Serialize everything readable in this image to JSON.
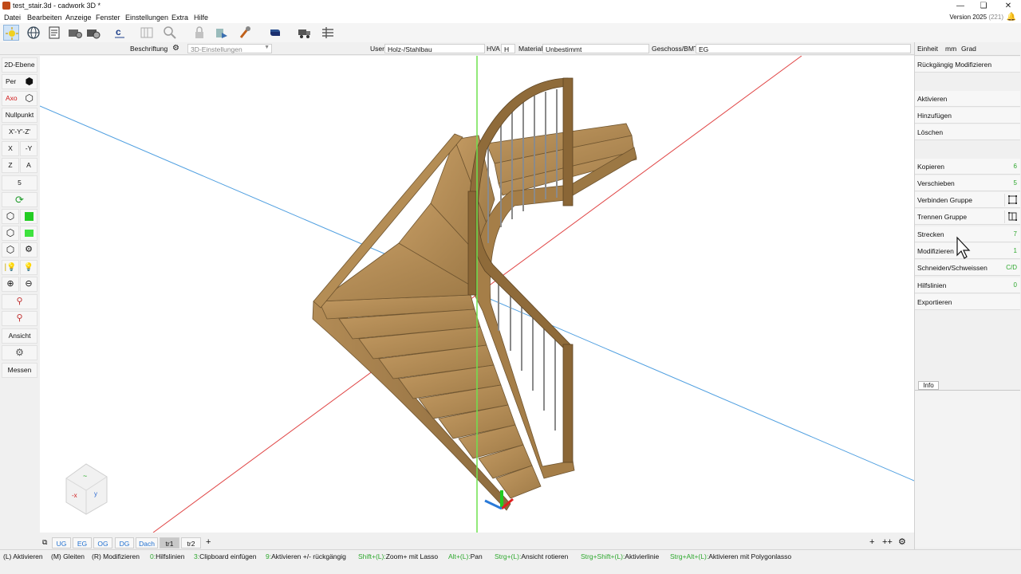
{
  "window": {
    "title": "test_stair.3d - cadwork 3D *",
    "version_label": "Version 2025",
    "version_build": "(221)"
  },
  "menu": [
    "Datei",
    "Bearbeiten",
    "Anzeige",
    "Fenster",
    "Einstellungen",
    "Extra",
    "Hilfe"
  ],
  "propbar": {
    "beschriftung": "Beschriftung",
    "einstellungen_3d": "3D-Einstellungen",
    "user_label": "User",
    "user_value": "Holz-/Stahlbau",
    "hva_label": "HVA",
    "hva_value": "H",
    "material_label": "Material",
    "material_value": "Unbestimmt",
    "geschoss_label": "Geschoss/BMT",
    "geschoss_value": "EG"
  },
  "right_header": {
    "einheit": "Einheit",
    "unit": "mm",
    "angle": "Grad"
  },
  "left_toolbar": {
    "ebene_2d": "2D-Ebene",
    "per": "Per",
    "axo": "Axo",
    "nullpunkt": "Nullpunkt",
    "axes": "X'-Y'-Z'",
    "x": "X",
    "neg_y": "-Y",
    "z": "Z",
    "a": "A",
    "five": "5",
    "ansicht": "Ansicht",
    "messen": "Messen"
  },
  "right_panel": {
    "undo": "Rückgängig Modifizieren",
    "aktivieren": "Aktivieren",
    "hinzufuegen": "Hinzufügen",
    "loeschen": "Löschen",
    "kopieren": {
      "label": "Kopieren",
      "key": "6"
    },
    "verschieben": {
      "label": "Verschieben",
      "key": "5"
    },
    "verbinden_gruppe": "Verbinden Gruppe",
    "trennen_gruppe": "Trennen Gruppe",
    "strecken": {
      "label": "Strecken",
      "key": "7"
    },
    "modifizieren": {
      "label": "Modifizieren",
      "key": "1"
    },
    "schneiden": {
      "label": "Schneiden/Schweissen",
      "key": "C/D"
    },
    "hilfslinien": {
      "label": "Hilfslinien",
      "key": "0"
    },
    "exportieren": "Exportieren",
    "info": "Info"
  },
  "floor_tabs": [
    "UG",
    "EG",
    "OG",
    "DG",
    "Dach",
    "tr1",
    "tr2"
  ],
  "floor_add": "+",
  "status": [
    {
      "key": "",
      "text": "(L) Aktivieren"
    },
    {
      "key": "",
      "text": "(M) Gleiten"
    },
    {
      "key": "",
      "text": "(R) Modifizieren"
    },
    {
      "key": "0:",
      "text": "Hilfslinien"
    },
    {
      "key": "3:",
      "text": "Clipboard einfügen"
    },
    {
      "key": "9:",
      "text": "Aktivieren +/- rückgängig"
    },
    {
      "key": "Shift+(L):",
      "text": "Zoom+ mit Lasso"
    },
    {
      "key": "Alt+(L):",
      "text": "Pan"
    },
    {
      "key": "Strg+(L):",
      "text": "Ansicht rotieren"
    },
    {
      "key": "Strg+Shift+(L):",
      "text": "Aktivierlinie"
    },
    {
      "key": "Strg+Alt+(L):",
      "text": "Aktivieren mit Polygonlasso"
    }
  ],
  "colors": {
    "wood_tread": "#b08a55",
    "wood_stringer": "#a7824d",
    "wood_dark": "#7e5f36",
    "axis_green": "#6fe24f",
    "axis_red": "#e04545",
    "axis_blue": "#4f9fe0",
    "shortcut_green": "#2ea82e"
  }
}
